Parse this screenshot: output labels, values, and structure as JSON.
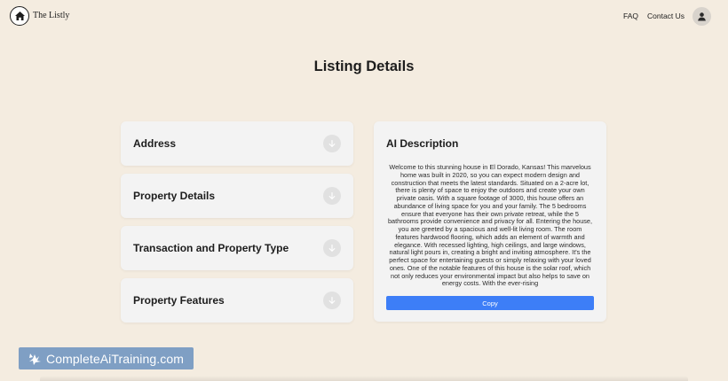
{
  "header": {
    "brand": "The Listly",
    "nav": [
      {
        "label": "FAQ"
      },
      {
        "label": "Contact Us"
      }
    ],
    "logo_icon": "house-icon",
    "avatar_icon": "user-icon"
  },
  "main": {
    "title": "Listing Details",
    "sections": [
      {
        "label": "Address",
        "icon": "arrow-down-icon"
      },
      {
        "label": "Property Details",
        "icon": "arrow-down-icon"
      },
      {
        "label": "Transaction and Property Type",
        "icon": "arrow-down-icon"
      },
      {
        "label": "Property Features",
        "icon": "arrow-down-icon"
      }
    ],
    "ai_panel": {
      "title": "AI Description",
      "text": "Welcome to this stunning house in El Dorado, Kansas! This marvelous home was built in 2020, so you can expect modern design and construction that meets the latest standards. Situated on a 2-acre lot, there is plenty of space to enjoy the outdoors and create your own private oasis. With a square footage of 3000, this house offers an abundance of living space for you and your family. The 5 bedrooms ensure that everyone has their own private retreat, while the 5 bathrooms provide convenience and privacy for all. Entering the house, you are greeted by a spacious and well-lit living room. The room features hardwood flooring, which adds an element of warmth and elegance. With recessed lighting, high ceilings, and large windows, natural light pours in, creating a bright and inviting atmosphere. It's the perfect space for entertaining guests or simply relaxing with your loved ones. One of the notable features of this house is the solar roof, which not only reduces your environmental impact but also helps to save on energy costs. With the ever-rising",
      "copy_label": "Copy"
    }
  },
  "watermark": {
    "text": "CompleteAiTraining.com"
  },
  "colors": {
    "background": "#f4ece0",
    "card": "#f3f3f3",
    "accent": "#3d7ef7",
    "watermark": "#7f9fc4"
  }
}
